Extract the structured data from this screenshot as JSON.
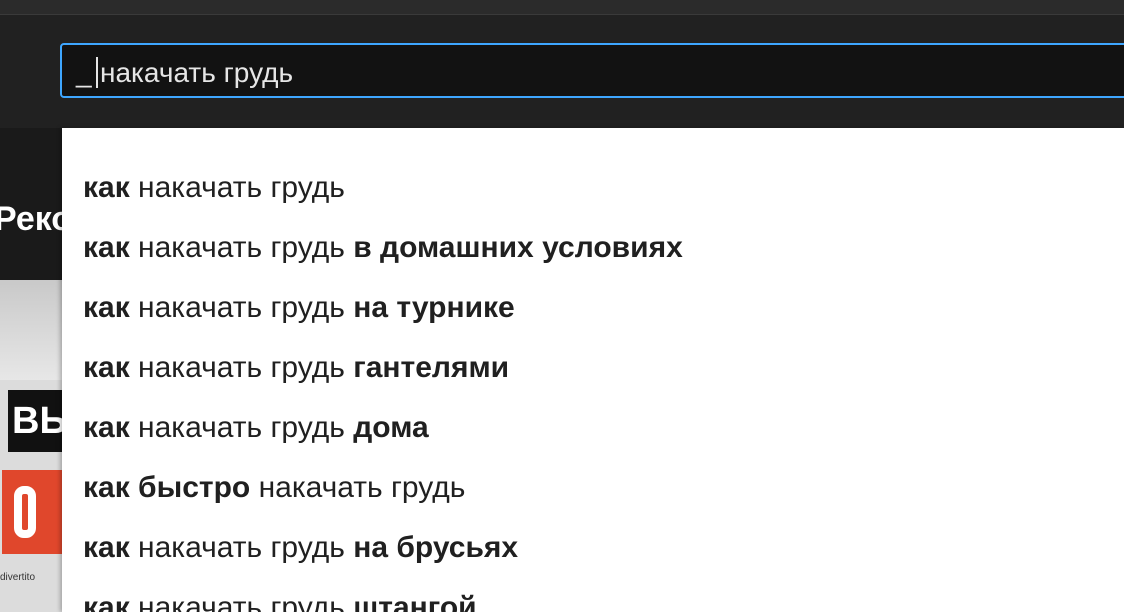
{
  "search": {
    "prefix": "_",
    "query": "накачать грудь"
  },
  "background": {
    "heading_fragment": "Реко",
    "tile_text": "ВЬ",
    "caption": "divertito"
  },
  "suggestions": [
    {
      "parts": [
        {
          "t": "как",
          "b": true
        },
        {
          "t": " накачать грудь",
          "b": false
        }
      ]
    },
    {
      "parts": [
        {
          "t": "как",
          "b": true
        },
        {
          "t": " накачать грудь ",
          "b": false
        },
        {
          "t": "в домашних условиях",
          "b": true
        }
      ]
    },
    {
      "parts": [
        {
          "t": "как",
          "b": true
        },
        {
          "t": " накачать грудь ",
          "b": false
        },
        {
          "t": "на турнике",
          "b": true
        }
      ]
    },
    {
      "parts": [
        {
          "t": "как",
          "b": true
        },
        {
          "t": " накачать грудь ",
          "b": false
        },
        {
          "t": "гантелями",
          "b": true
        }
      ]
    },
    {
      "parts": [
        {
          "t": "как",
          "b": true
        },
        {
          "t": " накачать грудь ",
          "b": false
        },
        {
          "t": "дома",
          "b": true
        }
      ]
    },
    {
      "parts": [
        {
          "t": "как быстро",
          "b": true
        },
        {
          "t": " накачать грудь",
          "b": false
        }
      ]
    },
    {
      "parts": [
        {
          "t": "как",
          "b": true
        },
        {
          "t": " накачать грудь ",
          "b": false
        },
        {
          "t": "на брусьях",
          "b": true
        }
      ]
    },
    {
      "parts": [
        {
          "t": "как",
          "b": true
        },
        {
          "t": " накачать грудь ",
          "b": false
        },
        {
          "t": "штангой",
          "b": true
        }
      ]
    }
  ],
  "colors": {
    "focus_border": "#3ea6ff",
    "dark_bg": "#212121",
    "dropdown_bg": "#ffffff"
  }
}
